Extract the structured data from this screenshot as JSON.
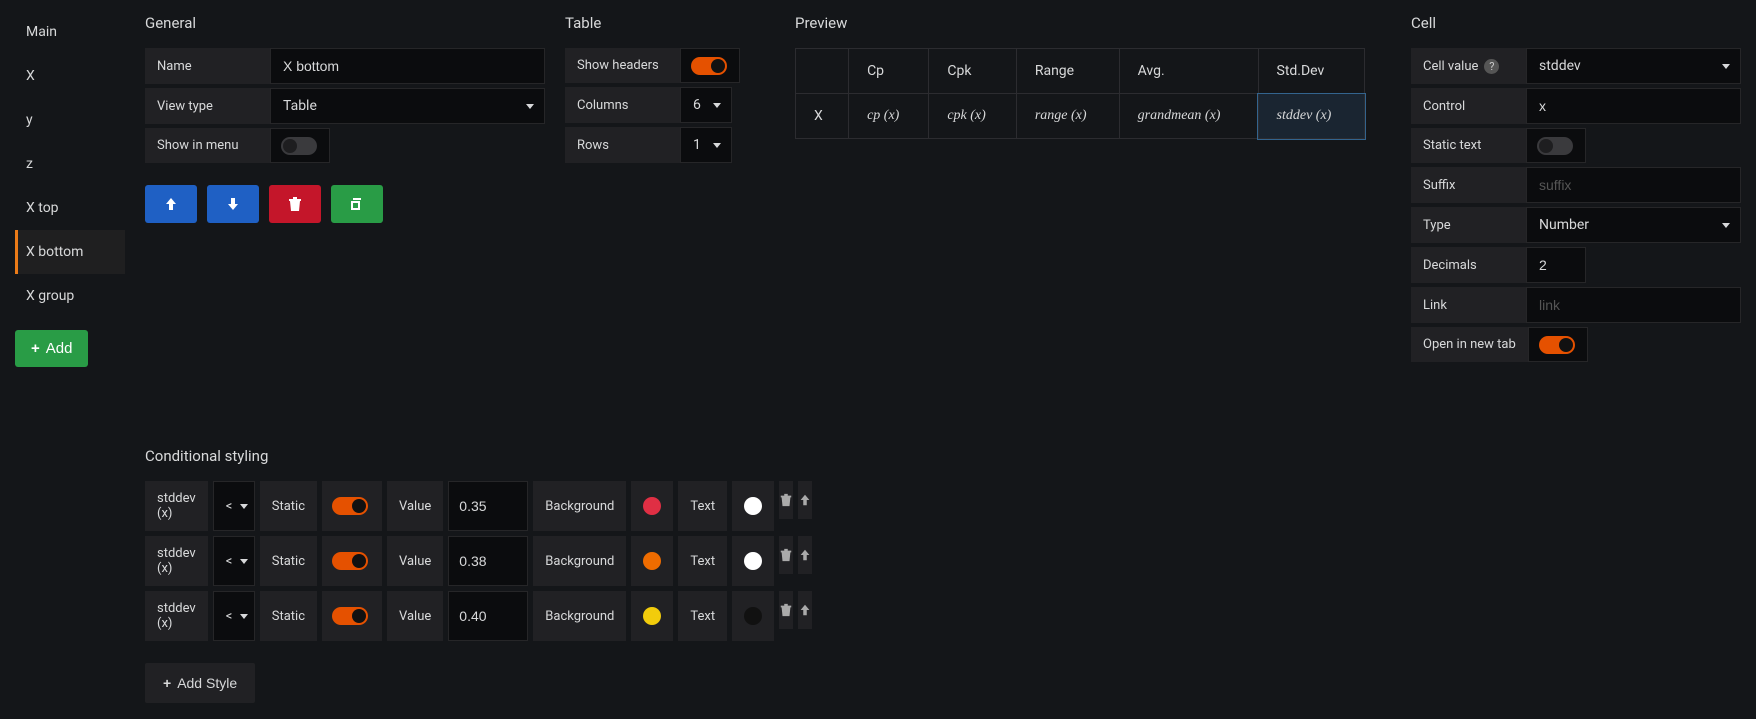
{
  "sidebar": {
    "items": [
      {
        "label": "Main"
      },
      {
        "label": "X"
      },
      {
        "label": "y"
      },
      {
        "label": "z"
      },
      {
        "label": "X top"
      },
      {
        "label": "X bottom"
      },
      {
        "label": "X group"
      }
    ],
    "active_index": 5,
    "add_label": "Add"
  },
  "general": {
    "title": "General",
    "name_label": "Name",
    "name_value": "X bottom",
    "view_type_label": "View type",
    "view_type_value": "Table",
    "show_in_menu_label": "Show in menu",
    "show_in_menu": false
  },
  "table": {
    "title": "Table",
    "show_headers_label": "Show headers",
    "show_headers": true,
    "columns_label": "Columns",
    "columns_value": "6",
    "rows_label": "Rows",
    "rows_value": "1"
  },
  "preview": {
    "title": "Preview",
    "headers": [
      "",
      "Cp",
      "Cpk",
      "Range",
      "Avg.",
      "Std.Dev"
    ],
    "row_label": "X",
    "cells": [
      "cp (x)",
      "cpk (x)",
      "range (x)",
      "grandmean (x)",
      "stddev (x)"
    ],
    "selected_col": 4
  },
  "cell": {
    "title": "Cell",
    "cell_value_label": "Cell value",
    "cell_value": "stddev",
    "control_label": "Control",
    "control_value": "x",
    "static_text_label": "Static text",
    "static_text": false,
    "suffix_label": "Suffix",
    "suffix_placeholder": "suffix",
    "type_label": "Type",
    "type_value": "Number",
    "decimals_label": "Decimals",
    "decimals_value": "2",
    "link_label": "Link",
    "link_placeholder": "link",
    "open_new_tab_label": "Open in new tab",
    "open_new_tab": true
  },
  "conditional": {
    "title": "Conditional styling",
    "static_label": "Static",
    "value_label": "Value",
    "background_label": "Background",
    "text_label": "Text",
    "add_style_label": "Add Style",
    "rows": [
      {
        "field": "stddev (x)",
        "op": "<",
        "static": true,
        "value": "0.35",
        "bg": "#e02f44",
        "text": "#ffffff"
      },
      {
        "field": "stddev (x)",
        "op": "<",
        "static": true,
        "value": "0.38",
        "bg": "#ef6c00",
        "text": "#ffffff"
      },
      {
        "field": "stddev (x)",
        "op": "<",
        "static": true,
        "value": "0.40",
        "bg": "#f2cc0c",
        "text": "#111111"
      }
    ]
  }
}
